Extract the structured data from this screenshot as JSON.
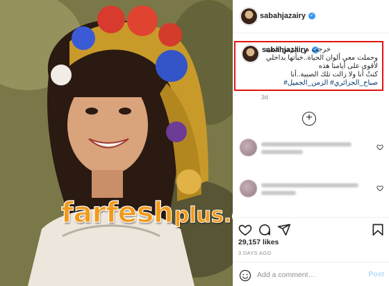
{
  "post": {
    "username": "sabahjazairy",
    "verified": true,
    "age": "3d",
    "likes": "29,157 likes",
    "date": "3 DAYS AGO"
  },
  "caption": {
    "lines": [
      "خرجت من الزمن البعيد",
      "وحملت معي ألوان الحياة..خبأتها بداخلي",
      "لأقوى على أيامنا هذه",
      "كنتُ أنا ولا زالت تلك الصبية..أنا"
    ],
    "hashtags": "صباح_الجزائري# الزمن_الجميل#"
  },
  "comment_box": {
    "placeholder": "Add a comment…",
    "post_label": "Post"
  },
  "watermark": {
    "main": "farfesh",
    "sub": "plus.com"
  },
  "colors": {
    "accent_blue": "#3897f0",
    "highlight_border": "#e31212",
    "post_disabled": "#b2dffc",
    "watermark": "#f29a1b"
  },
  "icons": [
    "like-icon",
    "comment-icon",
    "share-icon",
    "save-icon",
    "emoji-icon",
    "verified-icon",
    "add-circle-icon"
  ]
}
